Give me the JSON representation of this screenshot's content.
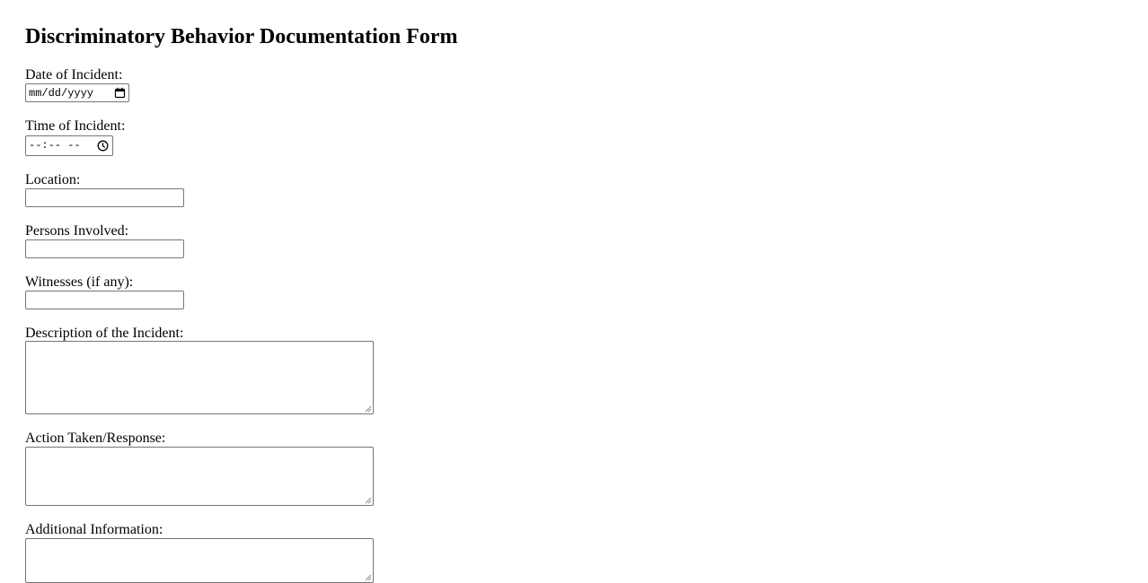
{
  "form": {
    "title": "Discriminatory Behavior Documentation Form",
    "date_label": "Date of Incident:",
    "date_placeholder": "mm/dd/yyyy",
    "time_label": "Time of Incident:",
    "time_placeholder": "--:-- --",
    "location_label": "Location:",
    "location_value": "",
    "persons_label": "Persons Involved:",
    "persons_value": "",
    "witnesses_label": "Witnesses (if any):",
    "witnesses_value": "",
    "description_label": "Description of the Incident:",
    "description_value": "",
    "action_label": "Action Taken/Response:",
    "action_value": "",
    "additional_label": "Additional Information:",
    "additional_value": ""
  },
  "icons": {
    "date_picker": "calendar-icon",
    "time_picker": "clock-icon",
    "textarea_grip": "resize-handle-icon"
  },
  "colors": {
    "text": "#000000",
    "border": "#767676",
    "background": "#ffffff"
  }
}
